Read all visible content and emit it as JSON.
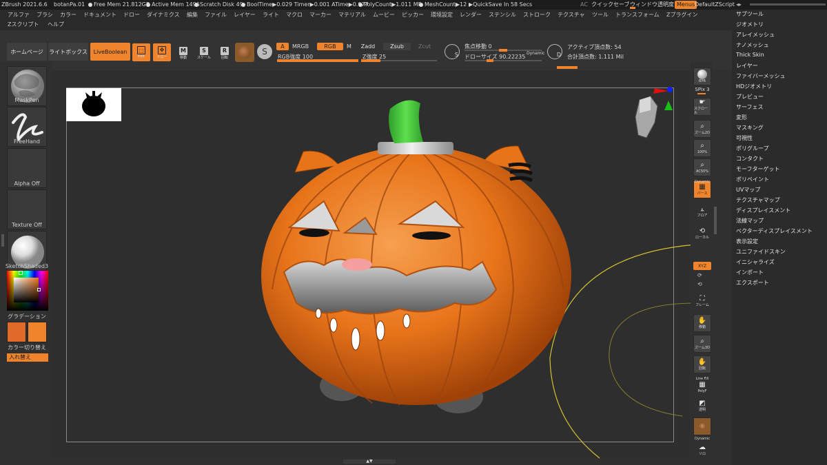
{
  "titlebar": {
    "app": "ZBrush 2021.6.6",
    "file": "botanPa.01",
    "free_mem": "Free Mem 21.812GB",
    "active_mem": "Active Mem 1496",
    "scratch": "Scratch Disk 49",
    "timings": "BoolTime▶0.029 Timer▶0.001 ATime▶0.077",
    "polycount": "PolyCount▶1.011 MP",
    "meshcount": "MeshCount▶12",
    "quicksave": "▶QuickSave In 58 Secs",
    "ac": "AC",
    "quick_save_btn": "クイックセーブ",
    "window_transparency": "ウィンドウ透明度",
    "menus_btn": "Menus",
    "script": "DefaultZScript"
  },
  "menubar": [
    "アルファ",
    "ブラシ",
    "カラー",
    "ドキュメント",
    "ドロー",
    "ダイナミクス",
    "編集",
    "ファイル",
    "レイヤー",
    "ライト",
    "マクロ",
    "マーカー",
    "マテリアル",
    "ムービー",
    "ピッカー",
    "環境設定",
    "レンダー",
    "ステンシル",
    "ストローク",
    "テクスチャ",
    "ツール",
    "トランスフォーム",
    "Zプラグイン",
    "Zスクリプト",
    "ヘルプ"
  ],
  "toolbar": {
    "home": "ホームページ",
    "lightbox": "ライトボックス",
    "liveboolean": "LiveBoolean",
    "edit": "Edit",
    "draw": "ドロー",
    "move": "移動",
    "scale": "スケール",
    "rotate": "回転",
    "a_btn": "A",
    "mrgb": "MRGB",
    "rgb": "RGB",
    "m": "M",
    "zadd": "Zadd",
    "zsub": "Zsub",
    "zcut": "Zcut",
    "rgb_intensity": "RGB強度 100",
    "z_intensity": "Z強度 25",
    "focal_shift": "焦点移動 0",
    "draw_size": "ドローサイズ 90.22235",
    "dynamic": "Dynamic",
    "active_points": "アクティブ頂点数: 54",
    "total_points": "合計頂点数: 1.111 Mil",
    "s_icon": "S",
    "d_icon": "D"
  },
  "sliders": {
    "rgb_intensity": 100,
    "z_intensity": 25,
    "focal_shift": 0
  },
  "leftpanel": {
    "brush": "MaskPen",
    "stroke": "FreeHand",
    "alpha": "Alpha Off",
    "texture": "Texture Off",
    "material": "SketchShaded3",
    "gradient": "グラデーション",
    "color_switch": "カラー切り替え",
    "swap": "入れ替え"
  },
  "rightshelf": {
    "bpr": "BPR",
    "spix": "SPix 3",
    "scroll": "スクロール",
    "zoom2d": "ズーム2D",
    "actual": "100%",
    "aahalf": "AC50%",
    "perspective": "パース",
    "dynamic": "Dynamic",
    "floor": "フロア",
    "local": "ローカル",
    "xyz": "XYZ",
    "frame": "フレーム",
    "move": "移動",
    "zoom3d": "ズーム3D",
    "rotate": "回転",
    "linefill": "Line Fill",
    "polyf": "PolyF",
    "transp": "透明",
    "dynamic2": "Dynamic",
    "solo": "ソロ"
  },
  "rightmenu": [
    "サブツール",
    "ジオメトリ",
    "アレイメッシュ",
    "ナノメッシュ",
    "Thick Skin",
    "レイヤー",
    "ファイバーメッシュ",
    "HDジオメトリ",
    "プレビュー",
    "サーフェス",
    "変形",
    "マスキング",
    "可視性",
    "ポリグループ",
    "コンタクト",
    "モーフターゲット",
    "ポリペイント",
    "UVマップ",
    "テクスチャマップ",
    "ディスプレイスメント",
    "法線マップ",
    "ベクターディスプレイスメント",
    "表示設定",
    "ユニファイドスキン",
    "イニシャライズ",
    "インポート",
    "エクスポート"
  ],
  "colors": {
    "accent": "#f0842c",
    "pumpkin": "#e8741a",
    "stem": "#3fc23a"
  }
}
